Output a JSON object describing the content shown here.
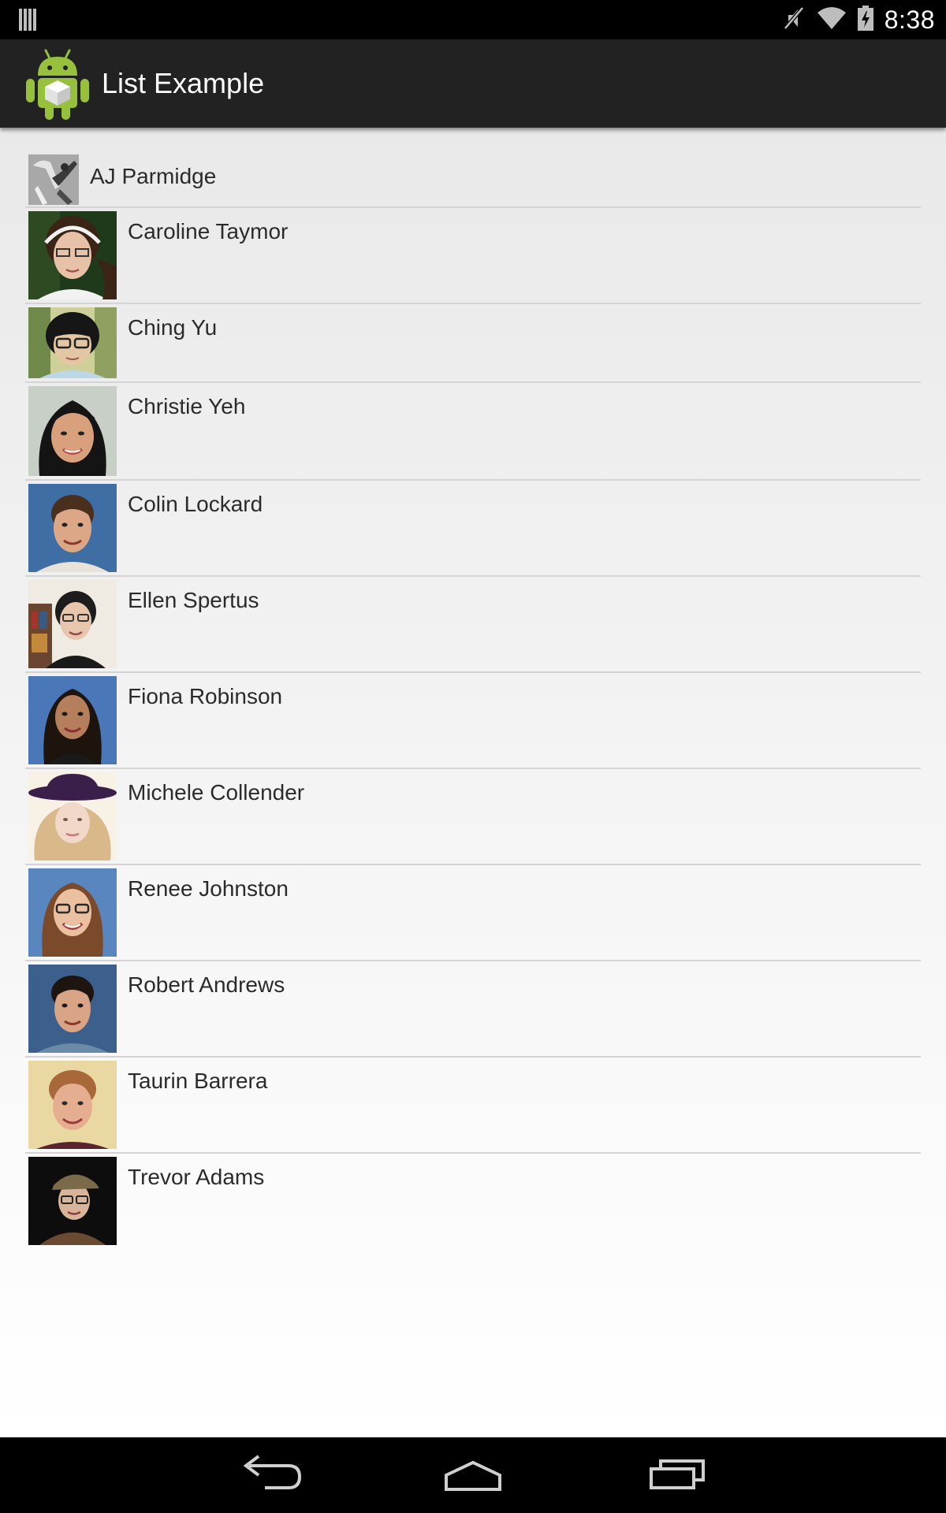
{
  "status_bar": {
    "time": "8:38",
    "icons": [
      "sim-card-icon",
      "mute-icon",
      "wifi-icon",
      "battery-charging-icon"
    ]
  },
  "action_bar": {
    "app_icon": "android-app-icon",
    "title": "List Example"
  },
  "contacts": [
    {
      "name": "AJ Parmidge",
      "photo": "contact-photo"
    },
    {
      "name": "Caroline Taymor",
      "photo": "contact-photo"
    },
    {
      "name": "Ching Yu",
      "photo": "contact-photo"
    },
    {
      "name": "Christie Yeh",
      "photo": "contact-photo"
    },
    {
      "name": "Colin Lockard",
      "photo": "contact-photo"
    },
    {
      "name": "Ellen Spertus",
      "photo": "contact-photo"
    },
    {
      "name": "Fiona Robinson",
      "photo": "contact-photo"
    },
    {
      "name": "Michele Collender",
      "photo": "contact-photo"
    },
    {
      "name": "Renee Johnston",
      "photo": "contact-photo"
    },
    {
      "name": "Robert Andrews",
      "photo": "contact-photo"
    },
    {
      "name": "Taurin Barrera",
      "photo": "contact-photo"
    },
    {
      "name": "Trevor Adams",
      "photo": "contact-photo"
    }
  ],
  "nav_bar": {
    "buttons": [
      "back-icon",
      "home-icon",
      "recent-apps-icon"
    ]
  },
  "colors": {
    "status_bar": "#000000",
    "action_bar": "#222222",
    "list_text": "#2b2b2b",
    "divider": "#d4d4d4",
    "android_green": "#97c03d"
  }
}
